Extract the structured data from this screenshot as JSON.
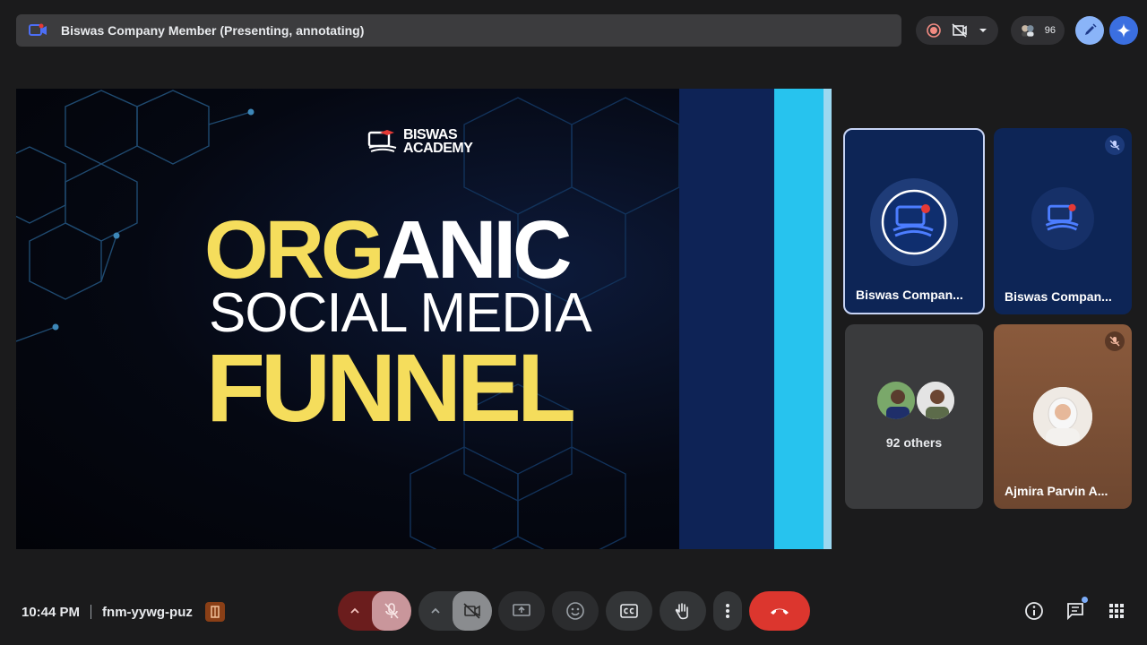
{
  "top_bar": {
    "title": "Biswas Company Member (Presenting, annotating)"
  },
  "top_controls": {
    "participant_count": "96"
  },
  "slide": {
    "brand_line1": "BISWAS",
    "brand_line2": "ACADEMY",
    "heading_part1": "ORG",
    "heading_part2": "ANIC",
    "heading_line2": "SOCIAL MEDIA",
    "heading_line3": "FUNNEL"
  },
  "tiles": [
    {
      "name": "Biswas Compan..."
    },
    {
      "name": "Biswas Compan..."
    },
    {
      "label": "92 others"
    },
    {
      "name": "Ajmira Parvin A..."
    }
  ],
  "bottom_bar": {
    "time": "10:44 PM",
    "meeting_code": "fnm-yywg-puz"
  },
  "colors": {
    "accent_yellow": "#f5dd5c",
    "end_call_red": "#dc362e",
    "tile_navy": "#0d2556",
    "cyan_band": "#27c3ee"
  },
  "icons": [
    "meet-logo-icon",
    "record-icon",
    "no-video-pin-icon",
    "chevron-down-icon",
    "people-icon",
    "pen-icon",
    "gemini-icon",
    "chevron-up-icon",
    "mic-off-icon",
    "camera-off-icon",
    "present-icon",
    "emoji-icon",
    "captions-icon",
    "raise-hand-icon",
    "more-icon",
    "end-call-icon",
    "info-icon",
    "chat-icon",
    "apps-grid-icon",
    "host-controls-icon"
  ]
}
